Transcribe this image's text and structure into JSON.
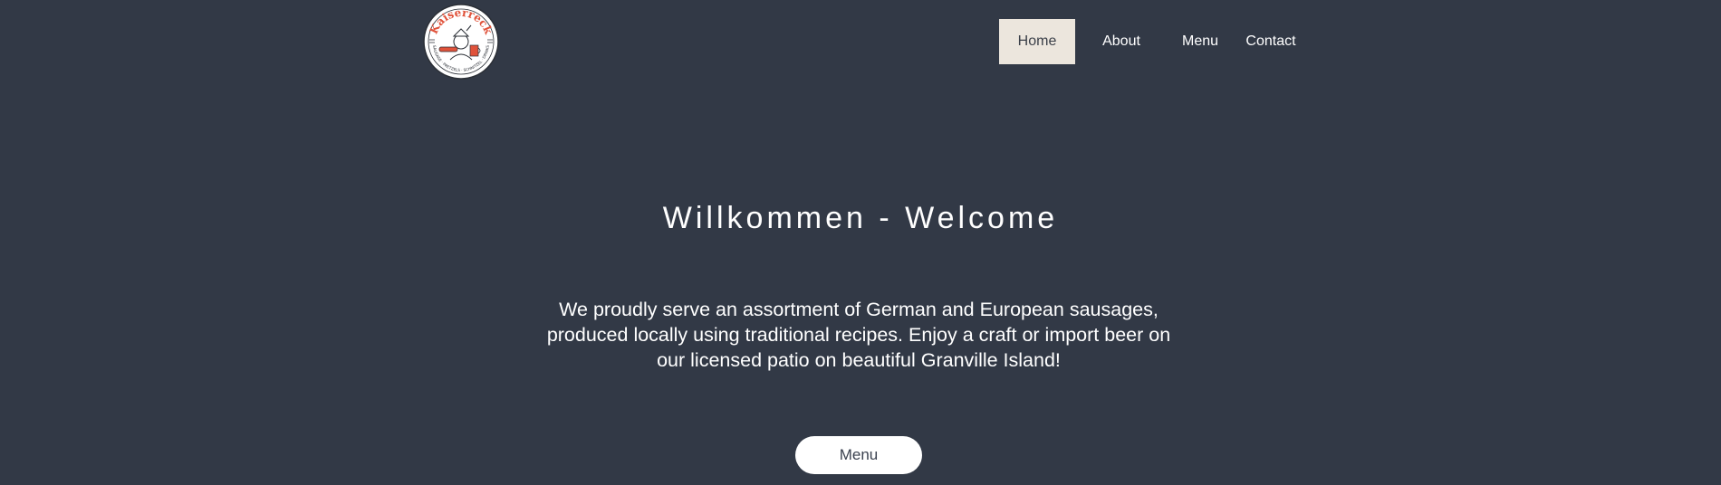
{
  "logo": {
    "text": "Kaiserreck",
    "ring_text": "SAUSAGE · PRETZELS · SCHNITZEL · DRINKS",
    "colors": {
      "ring": "#ffffff",
      "accent": "#e0523a",
      "ink": "#2b2f36"
    }
  },
  "nav": {
    "items": [
      {
        "label": "Home",
        "active": true
      },
      {
        "label": "About",
        "active": false
      },
      {
        "label": "Menu",
        "active": false
      },
      {
        "label": "Contact",
        "active": false
      }
    ]
  },
  "hero": {
    "title": "Willkommen - Welcome",
    "text": "We proudly serve an assortment of German and European sausages, produced locally using traditional recipes. Enjoy a craft or import beer on our licensed patio on beautiful Granville Island!",
    "button_label": "Menu"
  },
  "colors": {
    "background": "#323946",
    "active_nav_bg": "#ece6dd",
    "button_bg": "#ffffff"
  }
}
